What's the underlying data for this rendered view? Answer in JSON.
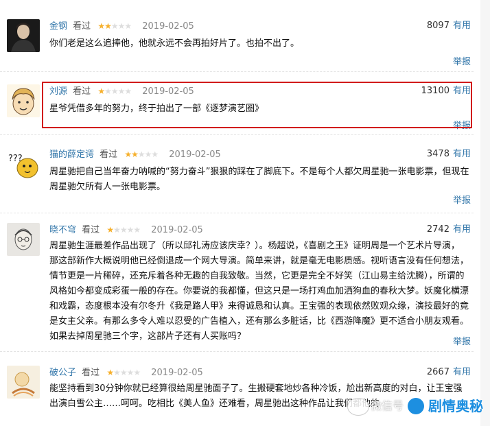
{
  "reviews": [
    {
      "user": "金钢",
      "watched": "看过",
      "rating": 2,
      "date": "2019-02-05",
      "useful_count": "8097",
      "useful_label": "有用",
      "lines": [
        "你们老是这么追捧他，他就永远不会再拍好片了。也拍不出了。"
      ],
      "report": "举报"
    },
    {
      "user": "刘源",
      "watched": "看过",
      "rating": 1,
      "date": "2019-02-05",
      "useful_count": "13100",
      "useful_label": "有用",
      "lines": [
        "星爷凭借多年的努力，终于拍出了一部《逐梦演艺圈》"
      ],
      "report": "举报"
    },
    {
      "user": "猫的薛定谔",
      "watched": "看过",
      "rating": 2,
      "date": "2019-02-05",
      "useful_count": "3478",
      "useful_label": "有用",
      "lines": [
        "周星驰把自己当年奋力呐喊的“努力奋斗”狠狠的踩在了脚底下。不是每个人都欠周星驰一张电影票，但现在",
        "周星驰欠所有人一张电影票。"
      ],
      "report": "举报"
    },
    {
      "user": "晓不穹",
      "watched": "看过",
      "rating": 1,
      "date": "2019-02-05",
      "useful_count": "2742",
      "useful_label": "有用",
      "lines": [
        "周星驰生涯最差作品出现了（所以邱礼涛应该庆幸？）。杨超说，《喜剧之王》证明周是一个艺术片导演，",
        "那这部新作大概说明他已经倒退成一个网大导演。简单来讲，就是毫无电影质感。视听语言没有任何想法，",
        "情节更是一片稀碎，还充斥着各种无趣的自我致敬。当然，它更是完全不好笑（江山易主给沈腾），所谓的",
        "风格如今都变成彩蛋一般的存在。你要说的我都懂，但这只是一场打鸡血加洒狗血的春秋大梦。妖魔化横漂",
        "和戏霸，态度根本没有尔冬升《我是路人甲》来得诚恳和认真。王宝强的表现依然败观众缘，演技最好的竟",
        "是女主父亲。有那么多令人难以忍受的广告植入，还有那么多脏话，比《西游降魔》更不适合小朋友观看。",
        "如果去掉周星驰三个字，这部片子还有人买账吗？"
      ],
      "report": "举报"
    },
    {
      "user": "破公子",
      "watched": "看过",
      "rating": 1,
      "date": "2019-02-05",
      "useful_count": "2667",
      "useful_label": "有用",
      "lines": [
        "能坚持看到30分钟你就已经算很给周星驰面子了。生搬硬套地炒各种冷饭，尬出新高度的对白，让王宝强",
        "出演白雪公主……呵呵。吃相比《美人鱼》还难看，周星驰出这种作品让我们都他的"
      ],
      "report": ""
    }
  ],
  "watermark": {
    "small": "微信号",
    "text": "剧情奥秘"
  }
}
